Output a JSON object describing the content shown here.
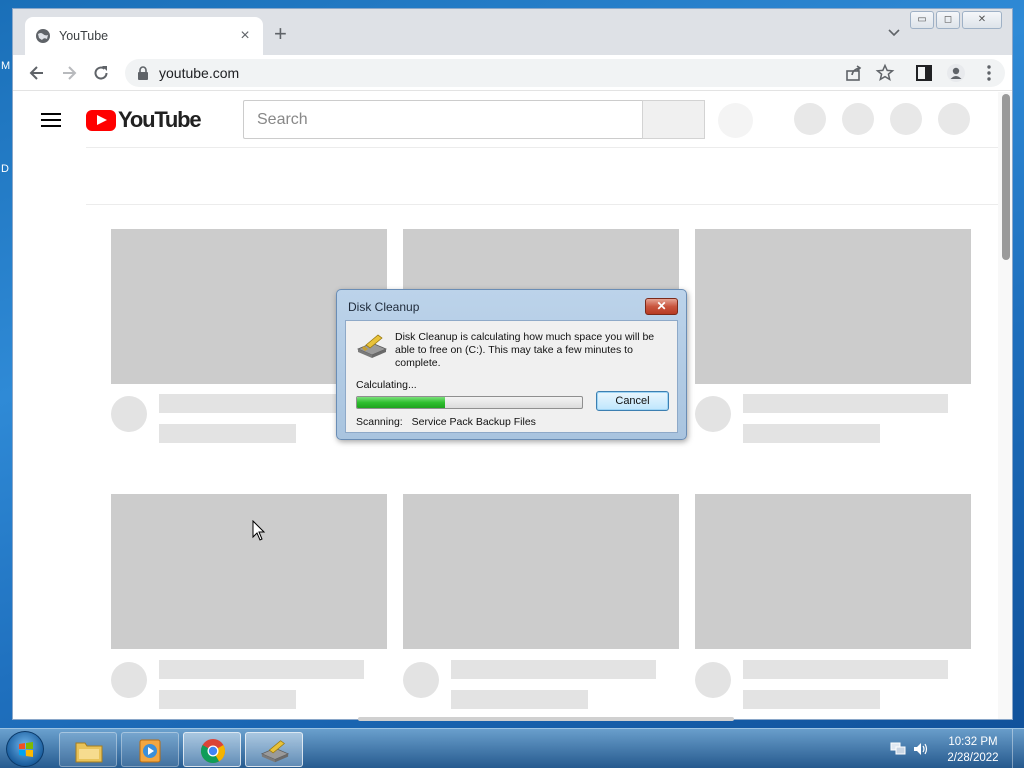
{
  "desktop": {
    "frag1": "M",
    "frag2": "D"
  },
  "browser": {
    "tab_title": "YouTube",
    "tab_close": "×",
    "new_tab": "+",
    "url": "youtube.com",
    "window_controls": {
      "minimize": "▭",
      "maximize": "◻",
      "close": "✕"
    }
  },
  "youtube": {
    "logo_text": "YouTube",
    "search_placeholder": "Search"
  },
  "dialog": {
    "title": "Disk Cleanup",
    "close": "✕",
    "message": "Disk Cleanup is calculating how much space you will be able to free on  (C:). This may take a few minutes to complete.",
    "status": "Calculating...",
    "progress_fraction": 0.39,
    "cancel_label": "Cancel",
    "scanning_label": "Scanning:",
    "scanning_value": "Service Pack Backup Files"
  },
  "taskbar": {
    "time": "10:32 PM",
    "date": "2/28/2022",
    "apps": [
      "windows-explorer",
      "media-player",
      "chrome",
      "disk-cleanup"
    ]
  }
}
